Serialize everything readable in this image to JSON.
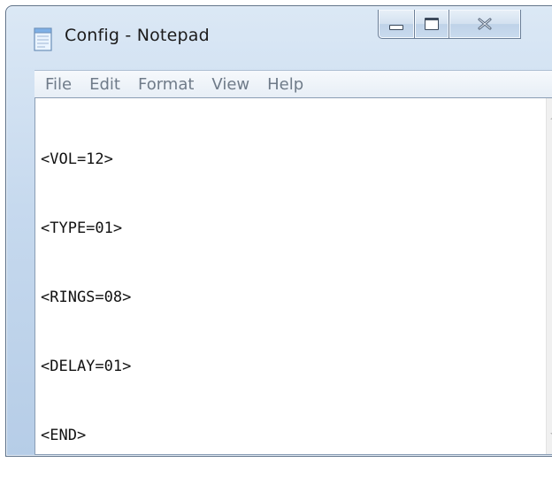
{
  "window": {
    "title": "Config - Notepad",
    "app_icon": "notepad-icon",
    "caption_buttons": {
      "minimize_icon": "minimize-icon",
      "maximize_icon": "maximize-icon",
      "close_icon": "close-icon",
      "close_glyph": "☒"
    }
  },
  "menubar": {
    "items": [
      {
        "label": "File"
      },
      {
        "label": "Edit"
      },
      {
        "label": "Format"
      },
      {
        "label": "View"
      },
      {
        "label": "Help"
      }
    ]
  },
  "editor": {
    "lines": [
      "<VOL=12>",
      "<TYPE=01>",
      "<RINGS=08>",
      "<DELAY=01>",
      "<END>"
    ]
  },
  "scrollbar": {
    "up_icon": "scroll-up-arrow-icon",
    "down_icon": "scroll-down-arrow-icon"
  }
}
